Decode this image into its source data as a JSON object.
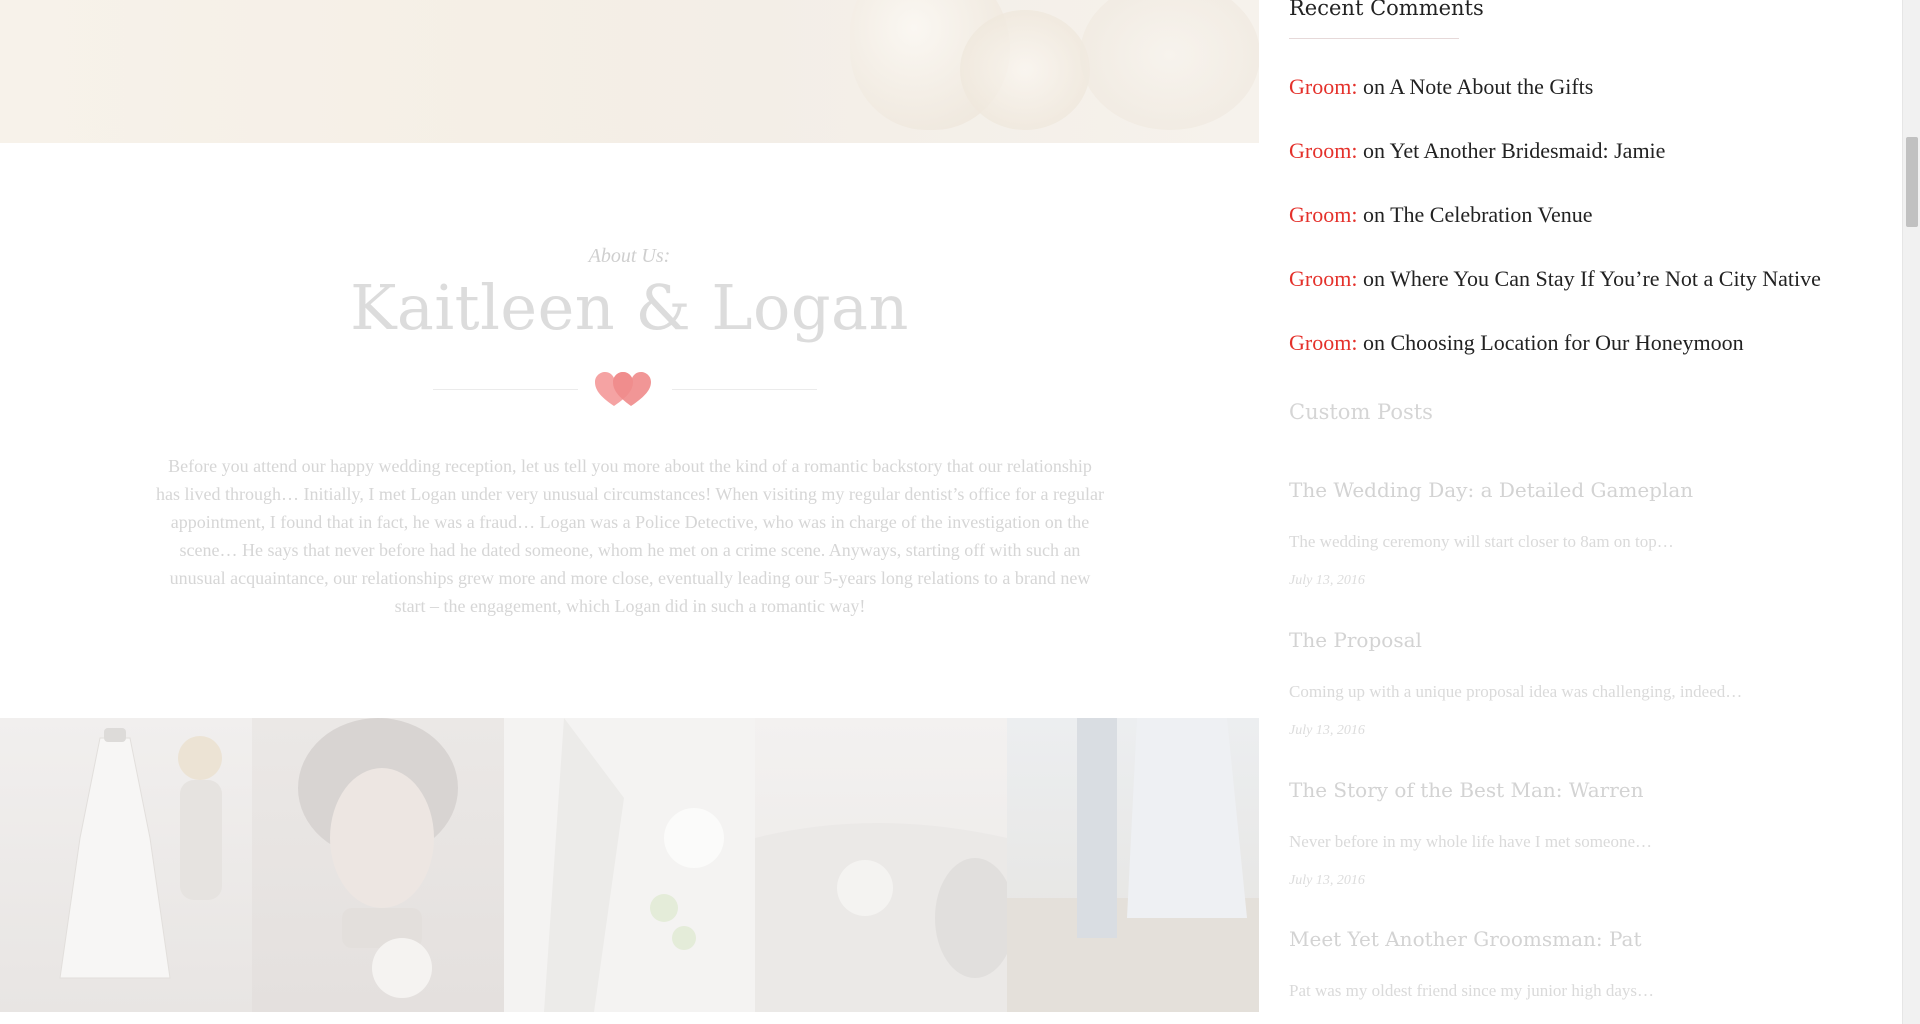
{
  "about": {
    "kicker": "About Us:",
    "title": "Kaitleen & Logan",
    "body": "Before you attend our happy wedding reception, let us tell you more about the kind of a romantic backstory that our relationship has lived through… Initially, I met Logan under very unusual circumstances! When visiting my regular dentist’s office for a regular appointment, I found that in fact, he was a fraud… Logan was a Police Detective, who was in charge of the investigation on the scene… He says that never before had he dated someone, whom he met on a crime scene. Anyways, starting off with such an unusual acquaintance, our relationships grew more and more close, eventually leading our 5-years long relations to a brand new start – the engagement, which Logan did in such a romantic way!"
  },
  "sidebar": {
    "recent_comments": {
      "title": "Recent Comments",
      "items": [
        {
          "author": "Groom:",
          "on": "on",
          "post": "A Note About the Gifts"
        },
        {
          "author": "Groom:",
          "on": "on",
          "post": "Yet Another Bridesmaid: Jamie"
        },
        {
          "author": "Groom:",
          "on": "on",
          "post": "The Celebration Venue"
        },
        {
          "author": "Groom:",
          "on": "on",
          "post": "Where You Can Stay If You’re Not a City Native"
        },
        {
          "author": "Groom:",
          "on": "on",
          "post": "Choosing Location for Our Honeymoon"
        }
      ]
    },
    "custom_posts": {
      "title": "Custom Posts",
      "items": [
        {
          "title": "The Wedding Day: a Detailed Gameplan",
          "excerpt": "The wedding ceremony will start closer to 8am on top…",
          "date": "July 13, 2016"
        },
        {
          "title": "The Proposal",
          "excerpt": "Coming up with a unique proposal idea was challenging, indeed…",
          "date": "July 13, 2016"
        },
        {
          "title": "The Story of the Best Man: Warren",
          "excerpt": "Never before in my whole life have I met someone…",
          "date": "July 13, 2016"
        },
        {
          "title": "Meet Yet Another Groomsman: Pat",
          "excerpt": "Pat was my oldest friend since my junior high days…"
        }
      ]
    }
  },
  "colors": {
    "accent": "#e4312b",
    "heart": "#f08b8b",
    "faded_text": "#d6d6d6"
  },
  "icons": {
    "divider": "hearts-icon"
  }
}
